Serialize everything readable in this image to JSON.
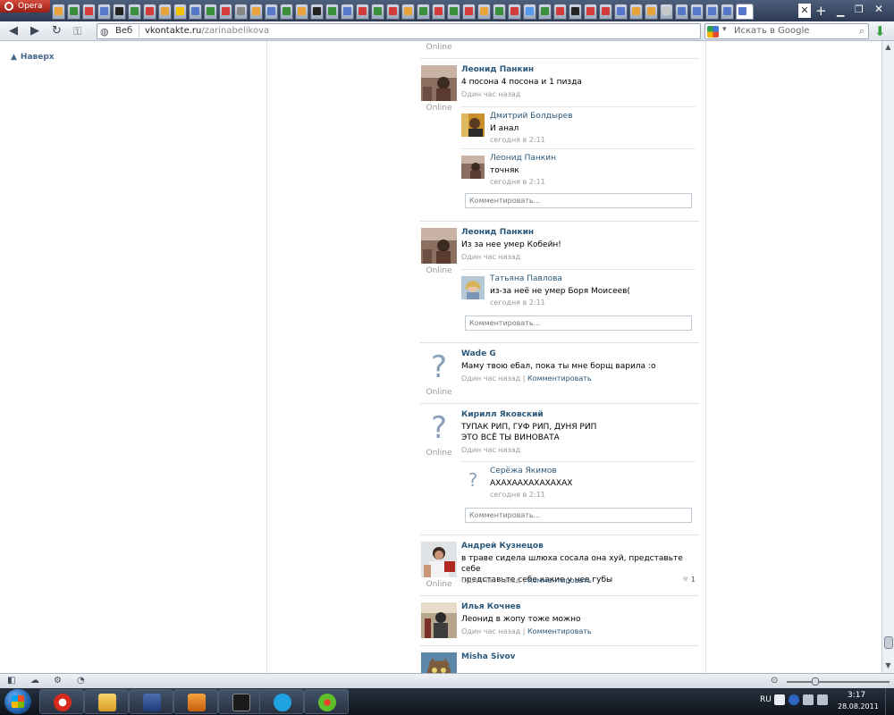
{
  "browser": {
    "menu_label": "Opera",
    "address": {
      "scheme": "Веб",
      "host": "vkontakte.ru",
      "path": "/zarinabelikova"
    },
    "search_placeholder": "Искать в Google",
    "tab_colors": [
      "#e8a33b",
      "#3a8f3a",
      "#d43b3b",
      "#5577cc",
      "#222222",
      "#3a8f3a",
      "#d43b3b",
      "#e8a33b",
      "#f2c300",
      "#5577cc",
      "#3a8f3a",
      "#d43b3b",
      "#888888",
      "#e8a33b",
      "#5577cc",
      "#3a8f3a",
      "#e8a33b",
      "#222222",
      "#3a8f3a",
      "#5577cc",
      "#d43b3b",
      "#3a8f3a",
      "#d43b3b",
      "#e8a33b",
      "#3a8f3a",
      "#d43b3b",
      "#3a8f3a",
      "#d43b3b",
      "#e8a33b",
      "#3a8f3a",
      "#d43b3b",
      "#5599ee",
      "#3a8f3a",
      "#d43b3b",
      "#222222",
      "#d43b3b",
      "#d43b3b",
      "#5577cc",
      "#e8a33b",
      "#e8a33b",
      "#c8c8c8",
      "#5577cc",
      "#5577cc",
      "#5577cc",
      "#5577cc",
      "#5577cc"
    ]
  },
  "page": {
    "back_to_top": "Наверх",
    "top_online": "Online",
    "comment_placeholder": "Комментировать...",
    "comment_link": "Комментировать",
    "posts": [
      {
        "author": "Леонид Панкин",
        "text": "4 посона 4 посона и 1 пизда",
        "time": "Один час назад",
        "online": "Online",
        "replies": [
          {
            "author": "Дмитрий Болдырев",
            "text": "И анал",
            "time": "сегодня в 2:11"
          },
          {
            "author": "Леонид Панкин",
            "text": "точняк",
            "time": "сегодня в 2:11"
          }
        ]
      },
      {
        "author": "Леонид Панкин",
        "text": "Из за нее умер Кобейн!",
        "time": "Один час назад",
        "online": "Online",
        "replies": [
          {
            "author": "Татьяна Павлова",
            "text": "из-за неё не умер Боря Моисеев(",
            "time": "сегодня в 2:11"
          }
        ]
      },
      {
        "author": "Wade G",
        "text": "Маму твою ебал, пока ты мне борщ варила :o",
        "time": "Один час назад",
        "online": "Online"
      },
      {
        "author": "Кирилл Яковский",
        "text_line1": "ТУПАК РИП, ГУФ РИП, ДУНЯ РИП",
        "text_line2": "ЭТО ВСЁ ТЫ ВИНОВАТА",
        "time": "Один час назад",
        "online": "Online",
        "replies": [
          {
            "author": "Серёжа Якимов",
            "text": "АХАХААХАХАХАХАХ",
            "time": "сегодня в 2:11"
          }
        ]
      },
      {
        "author": "Андрей Кузнецов",
        "text_line1": "в траве сидела шлюха сосала она хуй, представьте себе",
        "text_line2": "представьте себе какие у нее губы",
        "time": "Один час назад",
        "online": "Online",
        "likes": "1"
      },
      {
        "author": "Илья Кочнев",
        "text": "Леонид в жопу тоже можно",
        "time": "Один час назад"
      },
      {
        "author": "Misha Sivov"
      }
    ]
  },
  "taskbar": {
    "lang": "RU",
    "time": "3:17",
    "date": "28.08.2011"
  }
}
